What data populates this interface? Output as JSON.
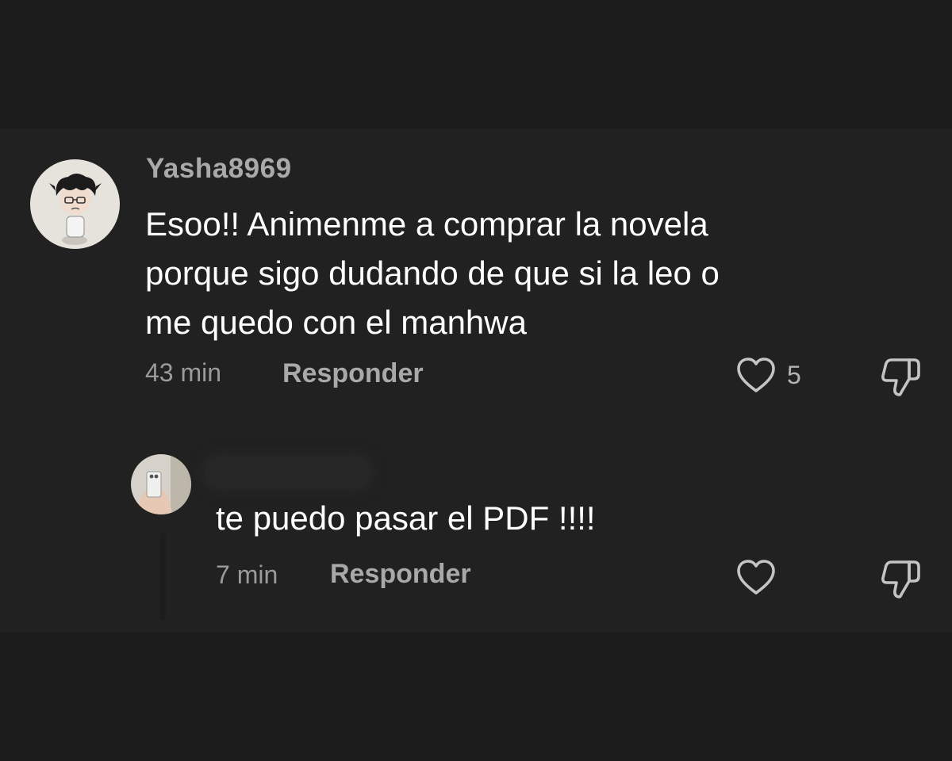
{
  "comment": {
    "username": "Yasha8969",
    "text_lines": [
      "Esoo!! Animenme a comprar la novela",
      "porque sigo dudando de que si la leo o",
      "me quedo con el manhwa"
    ],
    "time": "43 min",
    "reply_label": "Responder",
    "like_count": "5",
    "avatar_icon": "chibi-figure-avatar",
    "like_icon": "heart-outline-icon",
    "dislike_icon": "thumbs-down-icon"
  },
  "reply": {
    "username_hidden": true,
    "text": "te puedo pasar el PDF !!!!",
    "time": "7 min",
    "reply_label": "Responder",
    "avatar_icon": "mirror-selfie-avatar",
    "like_icon": "heart-outline-icon",
    "dislike_icon": "thumbs-down-icon"
  },
  "colors": {
    "background": "#1c1c1c",
    "panel": "#212121",
    "text_primary": "#ffffff",
    "text_secondary": "#a9a9a9"
  }
}
